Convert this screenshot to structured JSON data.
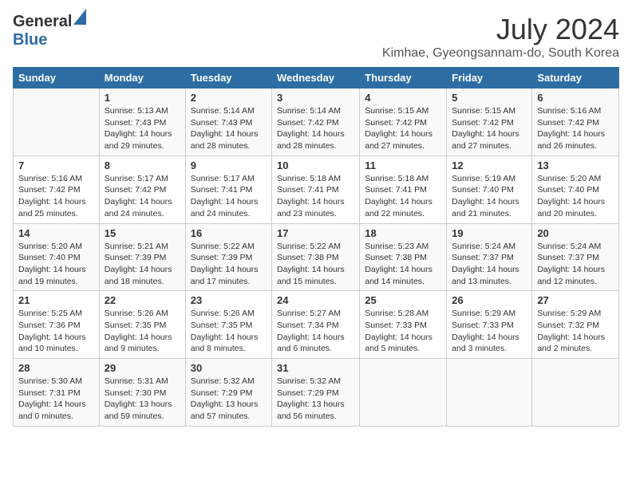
{
  "header": {
    "logo_general": "General",
    "logo_blue": "Blue",
    "month": "July 2024",
    "location": "Kimhae, Gyeongsannam-do, South Korea"
  },
  "weekdays": [
    "Sunday",
    "Monday",
    "Tuesday",
    "Wednesday",
    "Thursday",
    "Friday",
    "Saturday"
  ],
  "weeks": [
    [
      {
        "day": "",
        "info": ""
      },
      {
        "day": "1",
        "info": "Sunrise: 5:13 AM\nSunset: 7:43 PM\nDaylight: 14 hours\nand 29 minutes."
      },
      {
        "day": "2",
        "info": "Sunrise: 5:14 AM\nSunset: 7:43 PM\nDaylight: 14 hours\nand 28 minutes."
      },
      {
        "day": "3",
        "info": "Sunrise: 5:14 AM\nSunset: 7:42 PM\nDaylight: 14 hours\nand 28 minutes."
      },
      {
        "day": "4",
        "info": "Sunrise: 5:15 AM\nSunset: 7:42 PM\nDaylight: 14 hours\nand 27 minutes."
      },
      {
        "day": "5",
        "info": "Sunrise: 5:15 AM\nSunset: 7:42 PM\nDaylight: 14 hours\nand 27 minutes."
      },
      {
        "day": "6",
        "info": "Sunrise: 5:16 AM\nSunset: 7:42 PM\nDaylight: 14 hours\nand 26 minutes."
      }
    ],
    [
      {
        "day": "7",
        "info": "Sunrise: 5:16 AM\nSunset: 7:42 PM\nDaylight: 14 hours\nand 25 minutes."
      },
      {
        "day": "8",
        "info": "Sunrise: 5:17 AM\nSunset: 7:42 PM\nDaylight: 14 hours\nand 24 minutes."
      },
      {
        "day": "9",
        "info": "Sunrise: 5:17 AM\nSunset: 7:41 PM\nDaylight: 14 hours\nand 24 minutes."
      },
      {
        "day": "10",
        "info": "Sunrise: 5:18 AM\nSunset: 7:41 PM\nDaylight: 14 hours\nand 23 minutes."
      },
      {
        "day": "11",
        "info": "Sunrise: 5:18 AM\nSunset: 7:41 PM\nDaylight: 14 hours\nand 22 minutes."
      },
      {
        "day": "12",
        "info": "Sunrise: 5:19 AM\nSunset: 7:40 PM\nDaylight: 14 hours\nand 21 minutes."
      },
      {
        "day": "13",
        "info": "Sunrise: 5:20 AM\nSunset: 7:40 PM\nDaylight: 14 hours\nand 20 minutes."
      }
    ],
    [
      {
        "day": "14",
        "info": "Sunrise: 5:20 AM\nSunset: 7:40 PM\nDaylight: 14 hours\nand 19 minutes."
      },
      {
        "day": "15",
        "info": "Sunrise: 5:21 AM\nSunset: 7:39 PM\nDaylight: 14 hours\nand 18 minutes."
      },
      {
        "day": "16",
        "info": "Sunrise: 5:22 AM\nSunset: 7:39 PM\nDaylight: 14 hours\nand 17 minutes."
      },
      {
        "day": "17",
        "info": "Sunrise: 5:22 AM\nSunset: 7:38 PM\nDaylight: 14 hours\nand 15 minutes."
      },
      {
        "day": "18",
        "info": "Sunrise: 5:23 AM\nSunset: 7:38 PM\nDaylight: 14 hours\nand 14 minutes."
      },
      {
        "day": "19",
        "info": "Sunrise: 5:24 AM\nSunset: 7:37 PM\nDaylight: 14 hours\nand 13 minutes."
      },
      {
        "day": "20",
        "info": "Sunrise: 5:24 AM\nSunset: 7:37 PM\nDaylight: 14 hours\nand 12 minutes."
      }
    ],
    [
      {
        "day": "21",
        "info": "Sunrise: 5:25 AM\nSunset: 7:36 PM\nDaylight: 14 hours\nand 10 minutes."
      },
      {
        "day": "22",
        "info": "Sunrise: 5:26 AM\nSunset: 7:35 PM\nDaylight: 14 hours\nand 9 minutes."
      },
      {
        "day": "23",
        "info": "Sunrise: 5:26 AM\nSunset: 7:35 PM\nDaylight: 14 hours\nand 8 minutes."
      },
      {
        "day": "24",
        "info": "Sunrise: 5:27 AM\nSunset: 7:34 PM\nDaylight: 14 hours\nand 6 minutes."
      },
      {
        "day": "25",
        "info": "Sunrise: 5:28 AM\nSunset: 7:33 PM\nDaylight: 14 hours\nand 5 minutes."
      },
      {
        "day": "26",
        "info": "Sunrise: 5:29 AM\nSunset: 7:33 PM\nDaylight: 14 hours\nand 3 minutes."
      },
      {
        "day": "27",
        "info": "Sunrise: 5:29 AM\nSunset: 7:32 PM\nDaylight: 14 hours\nand 2 minutes."
      }
    ],
    [
      {
        "day": "28",
        "info": "Sunrise: 5:30 AM\nSunset: 7:31 PM\nDaylight: 14 hours\nand 0 minutes."
      },
      {
        "day": "29",
        "info": "Sunrise: 5:31 AM\nSunset: 7:30 PM\nDaylight: 13 hours\nand 59 minutes."
      },
      {
        "day": "30",
        "info": "Sunrise: 5:32 AM\nSunset: 7:29 PM\nDaylight: 13 hours\nand 57 minutes."
      },
      {
        "day": "31",
        "info": "Sunrise: 5:32 AM\nSunset: 7:29 PM\nDaylight: 13 hours\nand 56 minutes."
      },
      {
        "day": "",
        "info": ""
      },
      {
        "day": "",
        "info": ""
      },
      {
        "day": "",
        "info": ""
      }
    ]
  ]
}
